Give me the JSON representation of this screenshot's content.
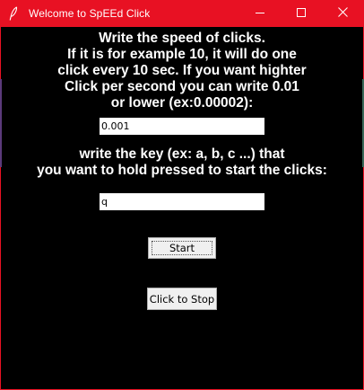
{
  "window": {
    "title": "Welcome to SpEEd Click",
    "accent_color": "#e81123",
    "icons": {
      "app": "feather-icon",
      "minimize": "minimize-icon",
      "maximize": "maximize-icon",
      "close": "close-icon"
    }
  },
  "speed": {
    "instructions": "Write the speed of clicks.\nIf it is for example 10, it will do one\nclick every 10 sec. If you want highter\nClick per second you can write 0.01\nor lower (ex:0.00002):",
    "value": "0.001"
  },
  "key": {
    "instructions": "write the key (ex: a, b, c ...) that\nyou want to hold pressed to start the clicks:",
    "value": "q"
  },
  "buttons": {
    "start_label": "Start",
    "stop_label": "Click to Stop"
  }
}
